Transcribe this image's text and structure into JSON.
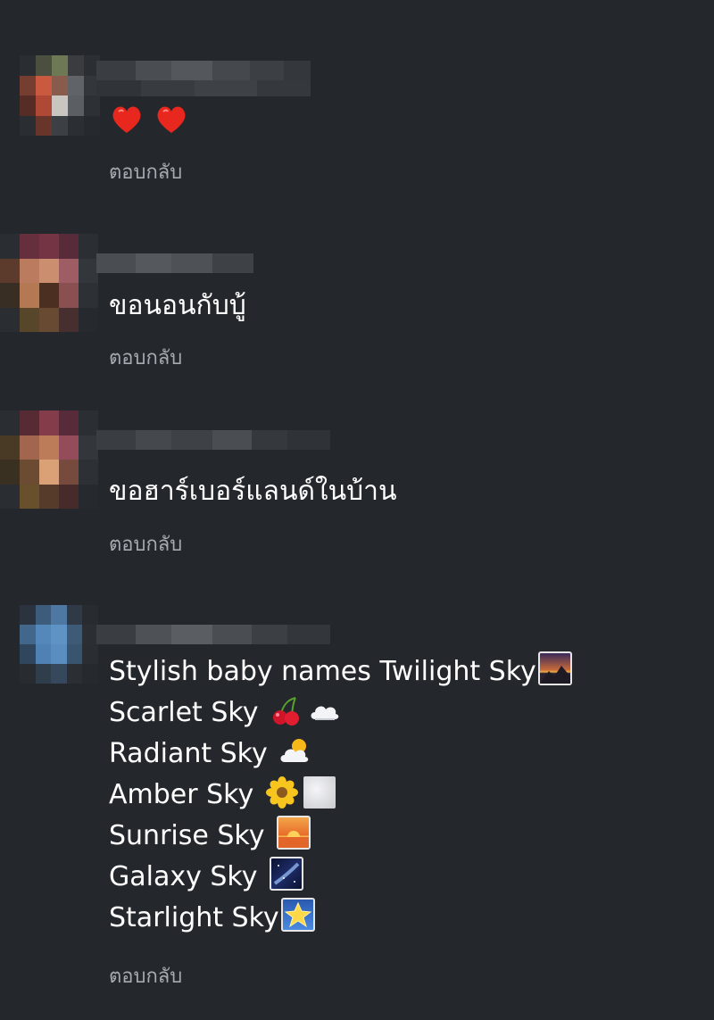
{
  "comments": [
    {
      "text": "",
      "emojis": [
        "red-heart",
        "red-heart"
      ],
      "reply_label": "ตอบกลับ"
    },
    {
      "text": "ขอนอนกับบู้",
      "reply_label": "ตอบกลับ"
    },
    {
      "text": "ขอฮาร์เบอร์แลนด์ในบ้าน",
      "reply_label": "ตอบกลับ"
    },
    {
      "lines": [
        {
          "text": "Stylish baby names  Twilight Sky",
          "emojis": [
            "sunrise-over-mountains"
          ]
        },
        {
          "text": "Scarlet Sky ",
          "emojis": [
            "cherries",
            "cloud"
          ]
        },
        {
          "text": "Radiant Sky ",
          "emojis": [
            "sun-behind-cloud"
          ]
        },
        {
          "text": "Amber Sky ",
          "emojis": [
            "blossom",
            "white-square"
          ]
        },
        {
          "text": "Sunrise Sky ",
          "emojis": [
            "sunrise"
          ]
        },
        {
          "text": "Galaxy Sky ",
          "emojis": [
            "milky-way"
          ]
        },
        {
          "text": "Starlight Sky",
          "emojis": [
            "glowing-star"
          ]
        }
      ],
      "reply_label": "ตอบกลับ"
    }
  ]
}
